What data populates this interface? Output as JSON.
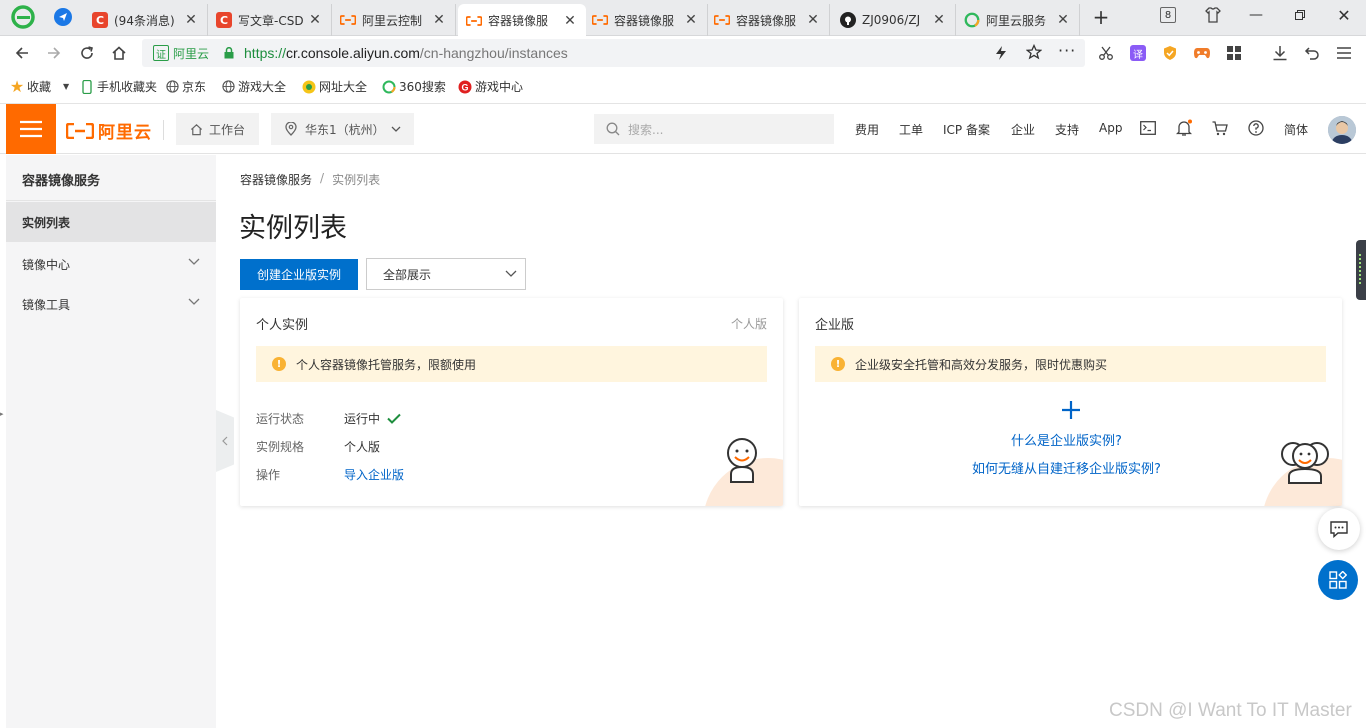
{
  "browser": {
    "tabs": [
      {
        "title": "(94条消息)",
        "icon": "csdn-icon",
        "color": "#e8452c"
      },
      {
        "title": "写文章-CSD",
        "icon": "csdn-icon",
        "color": "#e8452c"
      },
      {
        "title": "阿里云控制",
        "icon": "aliyun-icon",
        "color": "#ff6a00"
      },
      {
        "title": "容器镜像服",
        "icon": "aliyun-icon",
        "color": "#ff6a00"
      },
      {
        "title": "容器镜像服",
        "icon": "aliyun-icon",
        "color": "#ff6a00"
      },
      {
        "title": "容器镜像服",
        "icon": "aliyun-icon",
        "color": "#ff6a00"
      },
      {
        "title": "ZJ0906/ZJ",
        "icon": "github-icon",
        "color": "#222222"
      },
      {
        "title": "阿里云服务",
        "icon": "search-360-icon",
        "color": "#2fb85c"
      }
    ],
    "tab_count": "8",
    "url_badge": "阿里云",
    "url_scheme": "https://",
    "url_host": "cr.console.aliyun.com",
    "url_path": "/cn-hangzhou/instances",
    "bookmarks": [
      "收藏",
      "手机收藏夹",
      "京东",
      "游戏大全",
      "网址大全",
      "360搜索",
      "游戏中心"
    ]
  },
  "console": {
    "logo_text": "阿里云",
    "workbench": "工作台",
    "region": "华东1（杭州）",
    "search_placeholder": "搜索...",
    "nav": [
      "费用",
      "工单",
      "ICP 备案",
      "企业",
      "支持",
      "App"
    ],
    "lang": "简体"
  },
  "sidebar": {
    "title": "容器镜像服务",
    "items": [
      {
        "label": "实例列表"
      },
      {
        "label": "镜像中心"
      },
      {
        "label": "镜像工具"
      }
    ]
  },
  "main": {
    "breadcrumb": [
      "容器镜像服务",
      "实例列表"
    ],
    "page_title": "实例列表",
    "create_button": "创建企业版实例",
    "filter_value": "全部展示",
    "personal_card": {
      "title": "个人实例",
      "badge": "个人版",
      "notice": "个人容器镜像托管服务，限额使用",
      "rows": [
        {
          "label": "运行状态",
          "value": "运行中"
        },
        {
          "label": "实例规格",
          "value": "个人版"
        },
        {
          "label": "操作",
          "value": "导入企业版"
        }
      ]
    },
    "enterprise_card": {
      "title": "企业版",
      "notice": "企业级安全托管和高效分发服务，限时优惠购买",
      "link1": "什么是企业版实例?",
      "link2": "如何无缝从自建迁移企业版实例?"
    }
  },
  "watermark": "CSDN @I Want To IT Master",
  "colors": {
    "accent": "#ff6a00",
    "primary": "#0070cc",
    "link": "#0064c8",
    "success": "#1e8e3e",
    "warning": "#f9b233"
  }
}
